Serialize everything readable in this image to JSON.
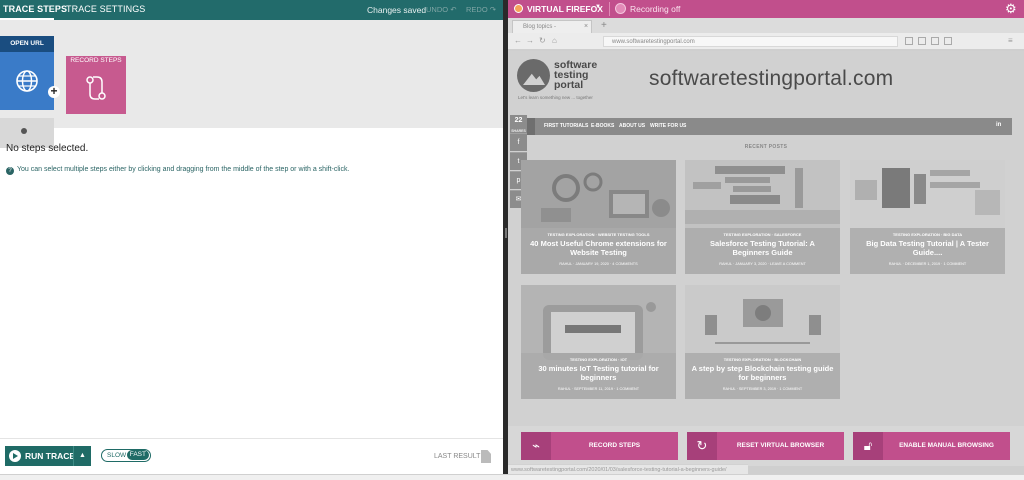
{
  "left": {
    "tabs": [
      "TRACE STEPS",
      "TRACE SETTINGS"
    ],
    "status": "Changes saved",
    "undo_label": "UNDO",
    "redo_label": "REDO",
    "steps": {
      "open_url_label": "OPEN URL",
      "record_steps_label": "RECORD STEPS"
    },
    "empty_message": "No steps selected.",
    "hint": "You can select multiple steps either by clicking and dragging from the middle of the step or with a shift-click.",
    "bottom": {
      "run_trace_label": "RUN TRACE",
      "speed_slow": "SLOW",
      "speed_fast": "FAST",
      "last_result_label": "LAST RESULT"
    }
  },
  "right": {
    "browser_name": "VIRTUAL FIREFOX",
    "recording_status": "Recording off",
    "tab_title": "Blog topics -",
    "url": "www.softwaretestingportal.com",
    "site": {
      "logo_lines": [
        "software",
        "testing",
        "portal"
      ],
      "tagline": "Let's learn something new ... together",
      "domain_heading": "softwaretestingportal.com",
      "nav_items": [
        "FIRST TUTORIALS",
        "E-BOOKS",
        "ABOUT US",
        "WRITE FOR US"
      ],
      "share_count": "22",
      "share_label": "SHARES",
      "recent_posts_label": "RECENT POSTS",
      "posts": [
        {
          "category": "TESTING EXPLORATION · WEBSITE TESTING TOOLS",
          "title": "40 Most Useful Chrome extensions for Website Testing",
          "meta": "RAHUL · JANUARY 19, 2020 · 4 COMMENTS"
        },
        {
          "category": "TESTING EXPLORATION · SALESFORCE",
          "title": "Salesforce Testing Tutorial: A Beginners Guide",
          "meta": "RAHUL · JANUARY 3, 2020 · LEAVE A COMMENT"
        },
        {
          "category": "TESTING EXPLORATION · BIG DATA",
          "title": "Big Data Testing Tutorial | A Tester Guide....",
          "meta": "RAHUL · DECEMBER 1, 2019 · 1 COMMENT"
        },
        {
          "category": "TESTING EXPLORATION · IOT",
          "title": "30 minutes IoT Testing tutorial for beginners",
          "meta": "RAHUL · SEPTEMBER 11, 2019 · 1 COMMENT"
        },
        {
          "category": "TESTING EXPLORATION · BLOCKCHAIN",
          "title": "A step by step Blockchain testing guide for beginners",
          "meta": "RAHUL · SEPTEMBER 3, 2019 · 1 COMMENT"
        }
      ]
    },
    "actions": [
      "RECORD STEPS",
      "RESET VIRTUAL BROWSER",
      "ENABLE MANUAL BROWSING"
    ],
    "status_url": "www.softwaretestingportal.com/2020/01/03/salesforce-testing-tutorial-a-beginners-guide/"
  },
  "colors": {
    "teal": "#226b6b",
    "magenta": "#c14f8c",
    "blue_step": "#3a7bc8"
  }
}
